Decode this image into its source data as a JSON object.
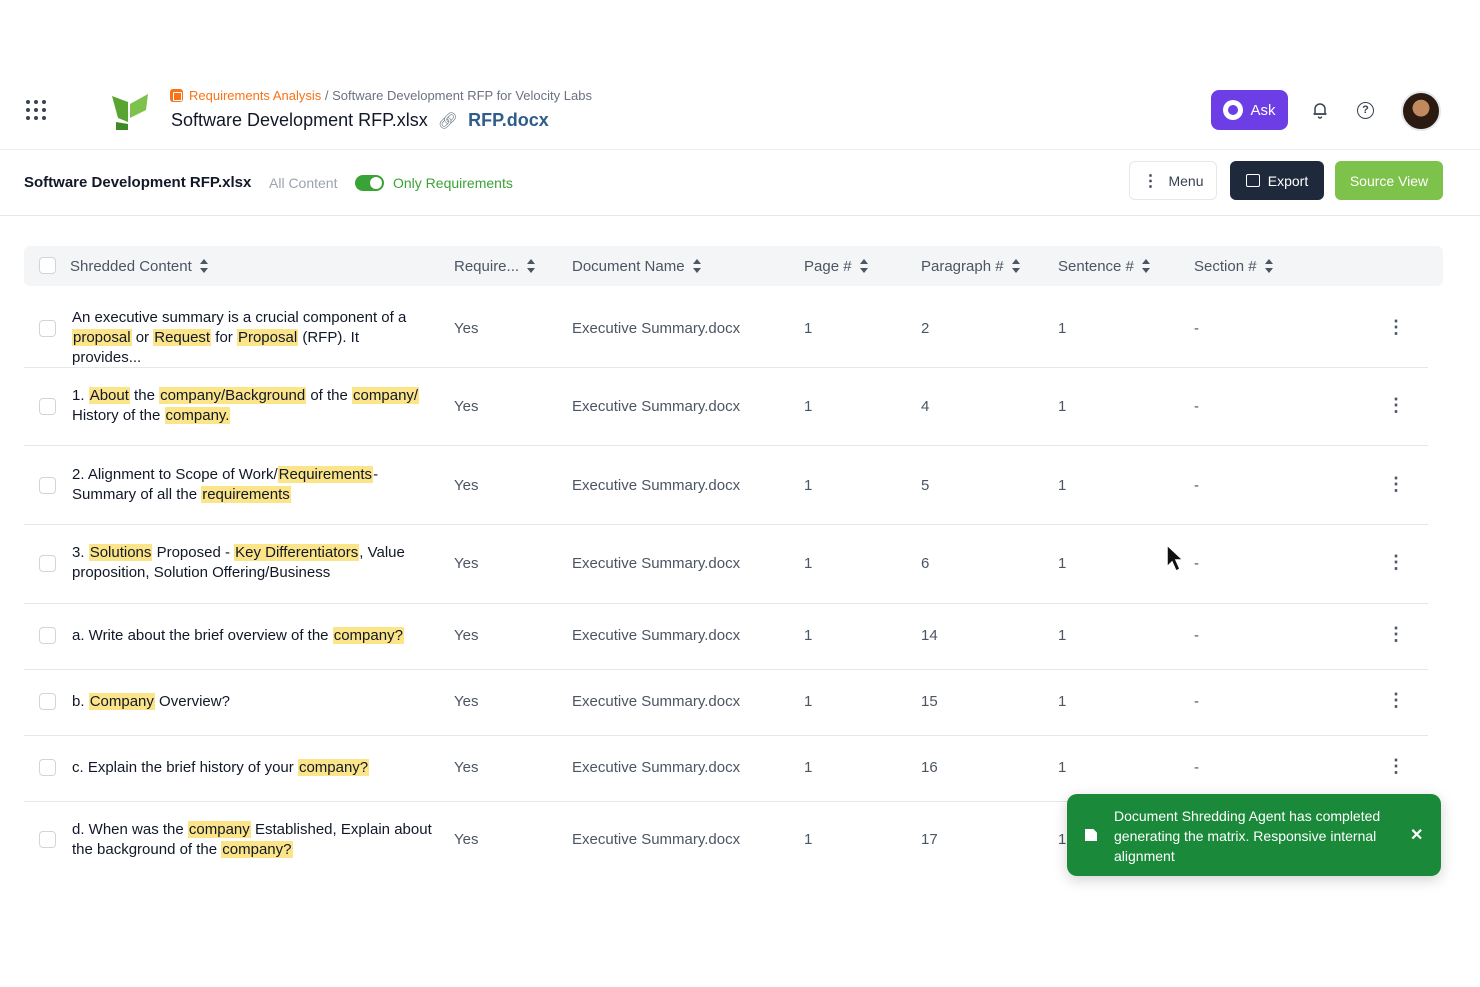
{
  "header": {
    "breadcrumb_link": "Requirements Analysis",
    "breadcrumb_rest": " / Software Development RFP for Velocity Labs",
    "file_title": "Software Development RFP.xlsx",
    "linked_file": "RFP.docx",
    "ask_label": "Ask"
  },
  "toolbar": {
    "file_name": "Software Development RFP.xlsx",
    "all_content_label": "All Content",
    "only_requirements_label": "Only Requirements",
    "toggle_on": true,
    "menu_label": "Menu",
    "export_label": "Export",
    "source_view_label": "Source View"
  },
  "table": {
    "columns": [
      "Shredded Content",
      "Require...",
      "Document Name",
      "Page #",
      "Paragraph #",
      "Sentence #",
      "Section #"
    ],
    "rows": [
      {
        "content": [
          [
            "An executive summary is a crucial component of a ",
            false
          ],
          [
            "proposal",
            true
          ],
          [
            " or ",
            false
          ],
          [
            "Request",
            true
          ],
          [
            " for ",
            false
          ],
          [
            "Proposal",
            true
          ],
          [
            " (RFP). It provides...",
            false
          ]
        ],
        "requirement": "Yes",
        "document": "Executive Summary.docx",
        "page": "1",
        "paragraph": "2",
        "sentence": "1",
        "section": "-"
      },
      {
        "content": [
          [
            "1. ",
            false
          ],
          [
            "About",
            true
          ],
          [
            " the ",
            false
          ],
          [
            "company/Background",
            true
          ],
          [
            " of the ",
            false
          ],
          [
            "company/",
            true
          ],
          [
            " History of the ",
            false
          ],
          [
            "company.",
            true
          ]
        ],
        "requirement": "Yes",
        "document": "Executive Summary.docx",
        "page": "1",
        "paragraph": "4",
        "sentence": "1",
        "section": "-"
      },
      {
        "content": [
          [
            "2. Alignment to Scope of Work/",
            false
          ],
          [
            "Requirements",
            true
          ],
          [
            "- Summary of all the ",
            false
          ],
          [
            "requirements",
            true
          ]
        ],
        "requirement": "Yes",
        "document": "Executive Summary.docx",
        "page": "1",
        "paragraph": "5",
        "sentence": "1",
        "section": "-"
      },
      {
        "content": [
          [
            "3. ",
            false
          ],
          [
            "Solutions",
            true
          ],
          [
            " Proposed - ",
            false
          ],
          [
            "Key Differentiators",
            true
          ],
          [
            ", Value proposition, Solution Offering/Business",
            false
          ]
        ],
        "requirement": "Yes",
        "document": "Executive Summary.docx",
        "page": "1",
        "paragraph": "6",
        "sentence": "1",
        "section": "-"
      },
      {
        "content": [
          [
            "a. Write about the brief overview of the ",
            false
          ],
          [
            "company?",
            true
          ]
        ],
        "requirement": "Yes",
        "document": "Executive Summary.docx",
        "page": "1",
        "paragraph": "14",
        "sentence": "1",
        "section": "-"
      },
      {
        "content": [
          [
            "b. ",
            false
          ],
          [
            "Company",
            true
          ],
          [
            " Overview?",
            false
          ]
        ],
        "requirement": "Yes",
        "document": "Executive Summary.docx",
        "page": "1",
        "paragraph": "15",
        "sentence": "1",
        "section": "-"
      },
      {
        "content": [
          [
            "c. Explain the brief history of your ",
            false
          ],
          [
            "company?",
            true
          ]
        ],
        "requirement": "Yes",
        "document": "Executive Summary.docx",
        "page": "1",
        "paragraph": "16",
        "sentence": "1",
        "section": "-"
      },
      {
        "content": [
          [
            "d. When was the ",
            false
          ],
          [
            "company",
            true
          ],
          [
            " Established, Explain about the background of the ",
            false
          ],
          [
            "company?",
            true
          ]
        ],
        "requirement": "Yes",
        "document": "Executive Summary.docx",
        "page": "1",
        "paragraph": "17",
        "sentence": "1",
        "section": ""
      }
    ]
  },
  "toast": {
    "message": "Document Shredding Agent has completed generating the matrix. Responsive internal alignment",
    "close_glyph": "✕"
  },
  "colors": {
    "ask_purple": "#6d3ee6",
    "export_navy": "#1e2a3b",
    "source_green": "#7dc24a",
    "toggle_green": "#3aa336",
    "toast_green": "#1a8a3a",
    "highlight_yellow": "#fce588",
    "breadcrumb_orange": "#f97316"
  },
  "icons": [
    "apps-grid-icon",
    "logo-icon",
    "link-icon",
    "sparkle-icon",
    "bell-icon",
    "help-icon",
    "sort-icon",
    "kebab-icon",
    "export-icon",
    "document-icon",
    "close-icon",
    "mouse-cursor-icon"
  ]
}
